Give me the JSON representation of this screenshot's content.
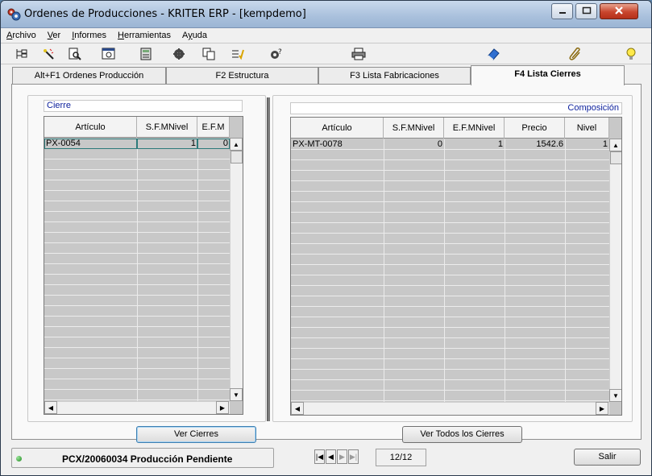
{
  "window": {
    "title": "Ordenes de Producciones - KRITER ERP - [kempdemo]"
  },
  "menu": [
    {
      "label": "Archivo",
      "u": 0
    },
    {
      "label": "Ver",
      "u": 0
    },
    {
      "label": "Informes",
      "u": 0
    },
    {
      "label": "Herramientas",
      "u": 0
    },
    {
      "label": "Ayuda",
      "u": 1
    }
  ],
  "toolbar_icons": [
    "tree-icon",
    "magic-wand-icon",
    "preview-icon",
    "zoom-window-icon",
    "calculator-icon",
    "gears-icon",
    "copy-icon",
    "checklist-icon",
    "help-gear-icon",
    "printer-icon",
    "eraser-icon",
    "paperclip-icon",
    "lightbulb-icon"
  ],
  "tabs": [
    {
      "label": "Alt+F1 Ordenes Producción",
      "active": false
    },
    {
      "label": "F2 Estructura",
      "active": false
    },
    {
      "label": "F3 Lista Fabricaciones",
      "active": false
    },
    {
      "label": "F4 Lista Cierres",
      "active": true
    }
  ],
  "left_panel": {
    "label": "Cierre",
    "columns": [
      "Artículo",
      "S.F.MNivel",
      "E.F.M"
    ],
    "rows": [
      [
        "PX-0054",
        "1",
        "0"
      ]
    ]
  },
  "right_panel": {
    "label": "Composición",
    "columns": [
      "Artículo",
      "S.F.MNivel",
      "E.F.MNivel",
      "Precio",
      "Nivel"
    ],
    "rows": [
      [
        "PX-MT-0078",
        "0",
        "1",
        "1542.6",
        "1"
      ]
    ]
  },
  "buttons": {
    "ver_cierres": "Ver Cierres",
    "ver_todos": "Ver Todos los Cierres",
    "salir": "Salir"
  },
  "status": {
    "text": "PCX/20060034 Producción Pendiente",
    "pager": "12/12"
  },
  "colors": {
    "section_label": "#0b1f9c",
    "grid_fill": "#c8c8c8",
    "status_led": "#1f8a1f"
  }
}
